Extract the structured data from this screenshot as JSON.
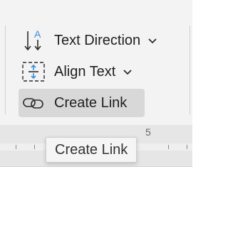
{
  "commands": [
    {
      "label": "Text Direction",
      "icon": "text-direction-icon",
      "has_dropdown": true
    },
    {
      "label": "Align Text",
      "icon": "align-text-icon",
      "has_dropdown": true
    },
    {
      "label": "Create Link",
      "icon": "link-icon",
      "has_dropdown": false,
      "selected": true
    }
  ],
  "ruler": {
    "number": "5"
  },
  "tooltip": {
    "text": "Create Link"
  },
  "colors": {
    "accent_icon": "#3a8fd8",
    "icon_dark": "#2b2b2b",
    "selected_bg": "#d8d8d8"
  }
}
